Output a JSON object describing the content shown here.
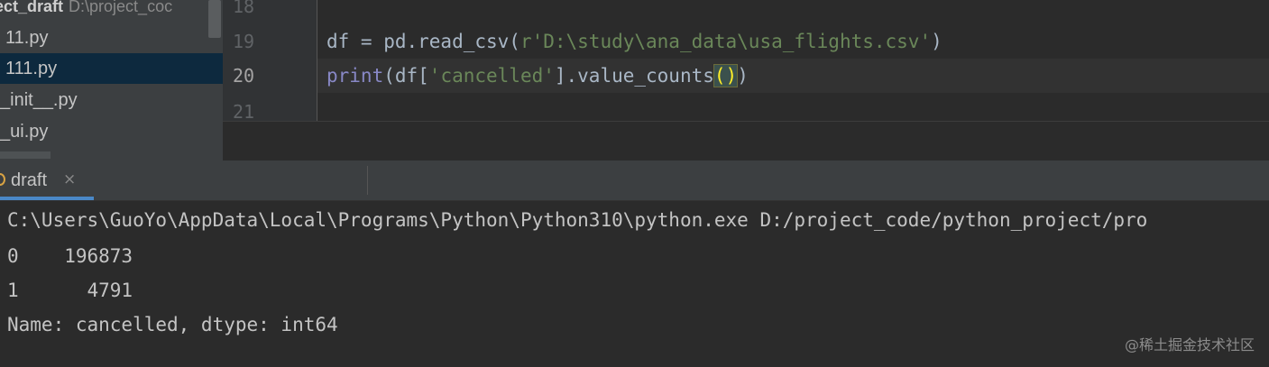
{
  "project": {
    "name": "ect_draft",
    "path": "D:\\project_coc"
  },
  "tree": {
    "items": [
      {
        "label": "11.py"
      },
      {
        "label": "111.py"
      },
      {
        "label": "_init__.py"
      },
      {
        "label": "_ui.py"
      }
    ]
  },
  "editor": {
    "line_numbers": [
      "18",
      "19",
      "20",
      "21"
    ],
    "line19": {
      "part1": "df = pd.read_csv(",
      "str": "r'D:\\study\\ana_data\\usa_flights.csv'",
      "part2": ")"
    },
    "line20": {
      "builtin": "print",
      "part1": "(df[",
      "str": "'cancelled'",
      "part2": "].value_counts",
      "paren": "()",
      "part3": ")"
    }
  },
  "run": {
    "tab_label": "draft",
    "close_glyph": "×",
    "console_lines": [
      "C:\\Users\\GuoYo\\AppData\\Local\\Programs\\Python\\Python310\\python.exe D:/project_code/python_project/pro",
      "0    196873",
      "1      4791",
      "Name: cancelled, dtype: int64"
    ]
  },
  "watermark": "@稀土掘金技术社区",
  "colors": {
    "accent": "#4a88c7",
    "string": "#6a8759",
    "builtin": "#8888c6"
  }
}
